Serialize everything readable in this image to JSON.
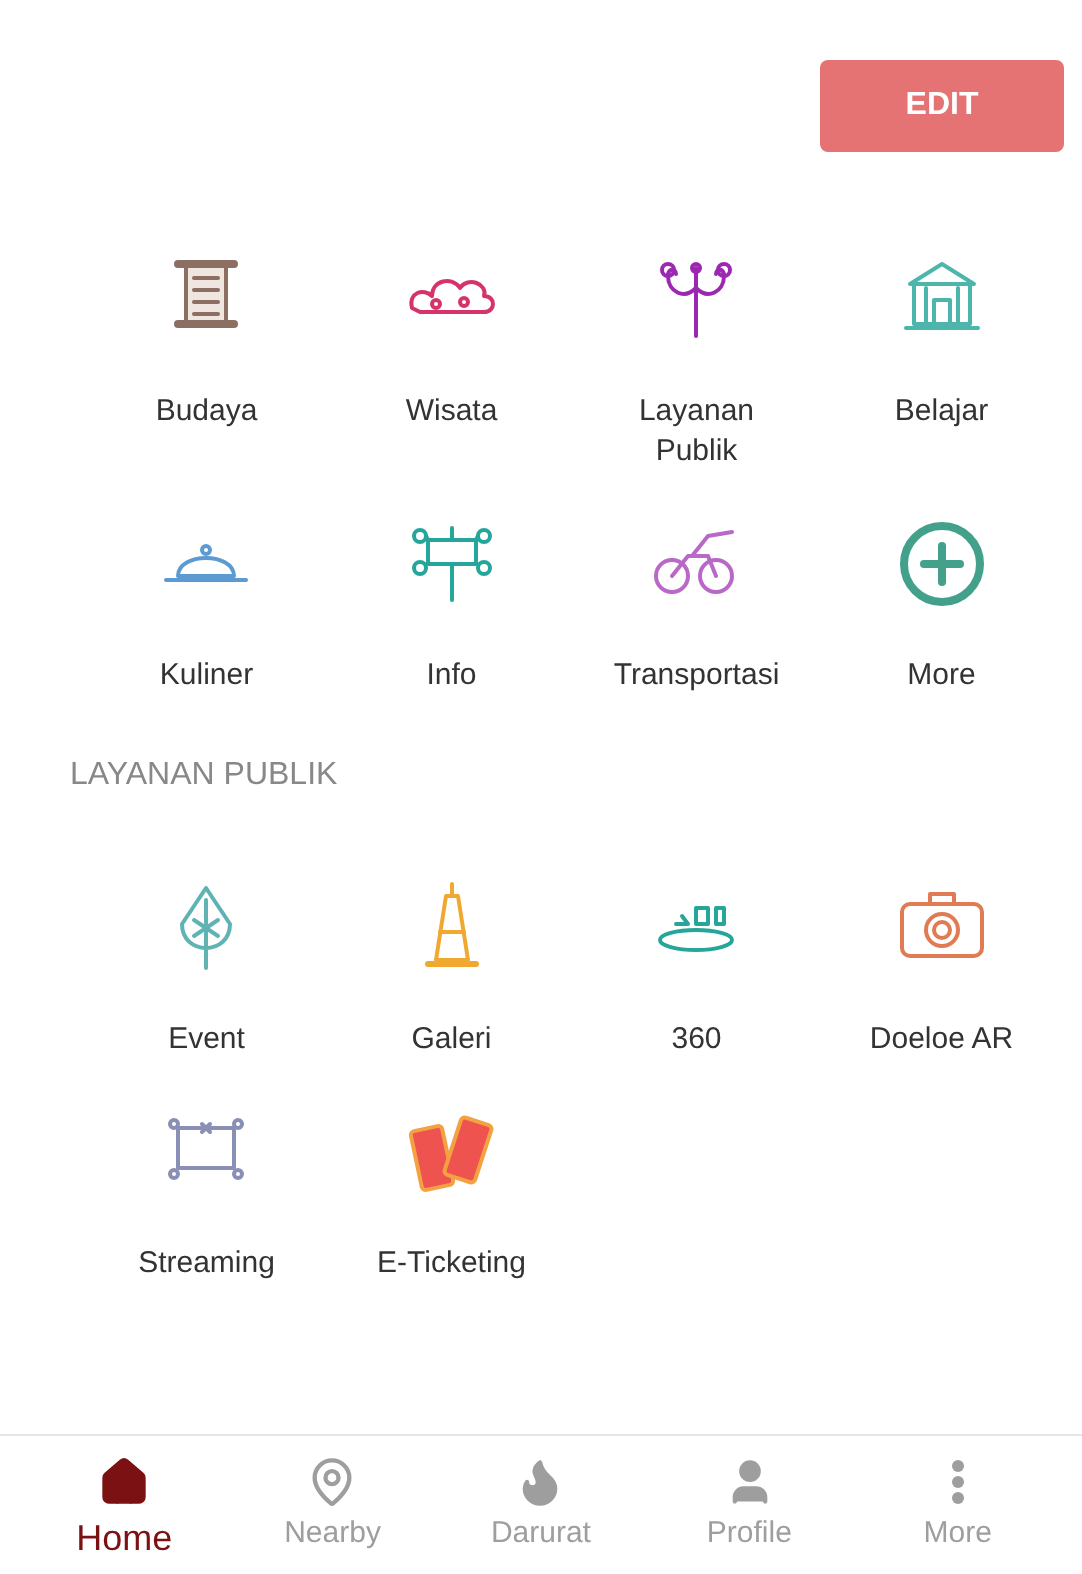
{
  "edit_button": {
    "label": "EDIT"
  },
  "main_menu": [
    {
      "label": "Budaya"
    },
    {
      "label": "Wisata"
    },
    {
      "label": "Layanan Publik"
    },
    {
      "label": "Belajar"
    },
    {
      "label": "Kuliner"
    },
    {
      "label": "Info"
    },
    {
      "label": "Transportasi"
    },
    {
      "label": "More"
    }
  ],
  "section": {
    "title": "LAYANAN PUBLIK",
    "items": [
      {
        "label": "Event"
      },
      {
        "label": "Galeri"
      },
      {
        "label": "360"
      },
      {
        "label": "Doeloe AR"
      },
      {
        "label": "Streaming"
      },
      {
        "label": "E-Ticketing"
      }
    ]
  },
  "bottom_nav": [
    {
      "label": "Home",
      "selected": true
    },
    {
      "label": "Nearby",
      "selected": false
    },
    {
      "label": "Darurat",
      "selected": false
    },
    {
      "label": "Profile",
      "selected": false
    },
    {
      "label": "More",
      "selected": false
    }
  ]
}
